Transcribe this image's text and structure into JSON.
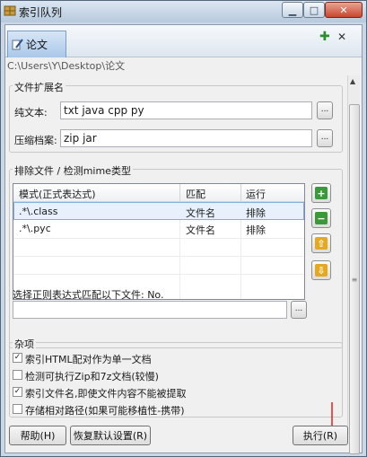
{
  "window": {
    "title": "索引队列",
    "minimize_glyph": "▁",
    "maximize_glyph": "□",
    "close_glyph": "✕"
  },
  "tabs": [
    {
      "label": "论文",
      "icon": "pencil-doc-icon"
    }
  ],
  "toolbar": {
    "add_glyph": "✚",
    "close_glyph": "✕"
  },
  "path": "C:\\Users\\Y\\Desktop\\论文",
  "file_extensions": {
    "title": "文件扩展名",
    "plain_text_label": "纯文本:",
    "plain_text_value": "txt java cpp py",
    "archive_label": "压缩档案:",
    "archive_value": "zip jar",
    "browse_label": "..."
  },
  "exclude": {
    "title": "排除文件 / 检测mime类型",
    "columns": [
      "模式(正式表达式)",
      "匹配",
      "运行"
    ],
    "rows": [
      {
        "pattern": ".*\\.class",
        "match": "文件名",
        "action": "排除"
      },
      {
        "pattern": ".*\\.pyc",
        "match": "文件名",
        "action": "排除"
      }
    ],
    "regex_label": "选择正则表达式匹配以下文件: No.",
    "regex_value": "",
    "browse_label": "...",
    "add_glyph": "+",
    "remove_glyph": "−",
    "up_glyph": "⇧",
    "down_glyph": "⇩"
  },
  "misc": {
    "title": "杂项",
    "options": [
      {
        "label": "索引HTML配对作为单一文档",
        "checked": true
      },
      {
        "label": "检测可执行Zip和7z文档(较慢)",
        "checked": false
      },
      {
        "label": "索引文件名,即使文件内容不能被提取",
        "checked": true
      },
      {
        "label": "存储相对路径(如果可能移植性-携带)",
        "checked": false
      }
    ]
  },
  "buttons": {
    "help": "帮助(H)",
    "restore_defaults": "恢复默认设置(R)",
    "run": "执行(R)"
  },
  "colors": {
    "accent": "#2e8b2e",
    "arrow": "#e0201a"
  }
}
